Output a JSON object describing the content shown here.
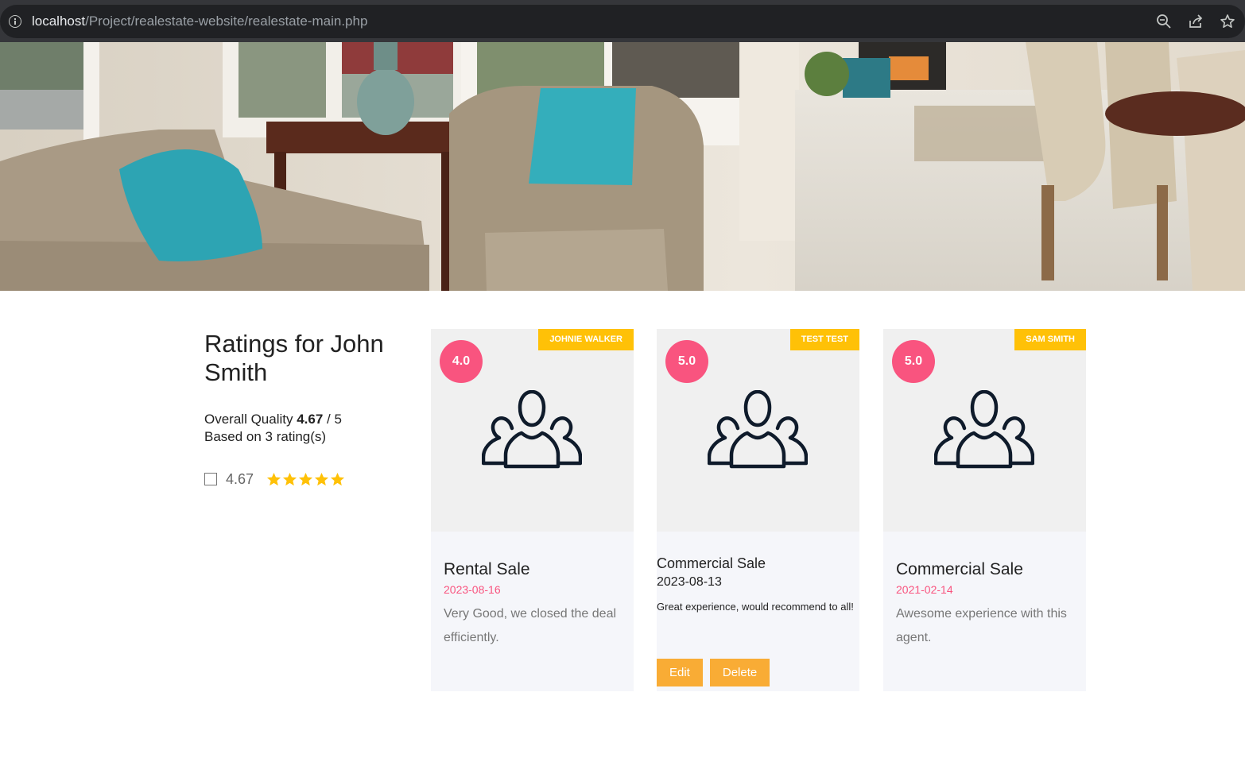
{
  "browser": {
    "url_host": "localhost",
    "url_path": "/Project/realestate-website/realestate-main.php"
  },
  "summary": {
    "title": "Ratings for John Smith",
    "quality_label": "Overall Quality ",
    "quality_value": "4.67",
    "quality_max": " / 5",
    "based_on": "Based on 3 rating(s)",
    "average": "4.67",
    "stars_filled": 5,
    "star_color": "#ffc107"
  },
  "reviews": [
    {
      "score": "4.0",
      "reviewer": "JOHNIE WALKER",
      "title": "Rental Sale",
      "date": "2023-08-16",
      "comment": "Very Good, we closed the deal efficiently."
    },
    {
      "score": "5.0",
      "reviewer": "TEST TEST",
      "title": "Commercial Sale",
      "date": "2023-08-13",
      "comment": "Great experience, would recommend to all!",
      "edit_label": "Edit",
      "delete_label": "Delete"
    },
    {
      "score": "5.0",
      "reviewer": "SAM SMITH",
      "title": "Commercial Sale",
      "date": "2021-02-14",
      "comment": "Awesome experience with this agent."
    }
  ],
  "colors": {
    "score_circle": "#f9547f",
    "agent_badge": "#ffc107",
    "button": "#f9ac35"
  }
}
